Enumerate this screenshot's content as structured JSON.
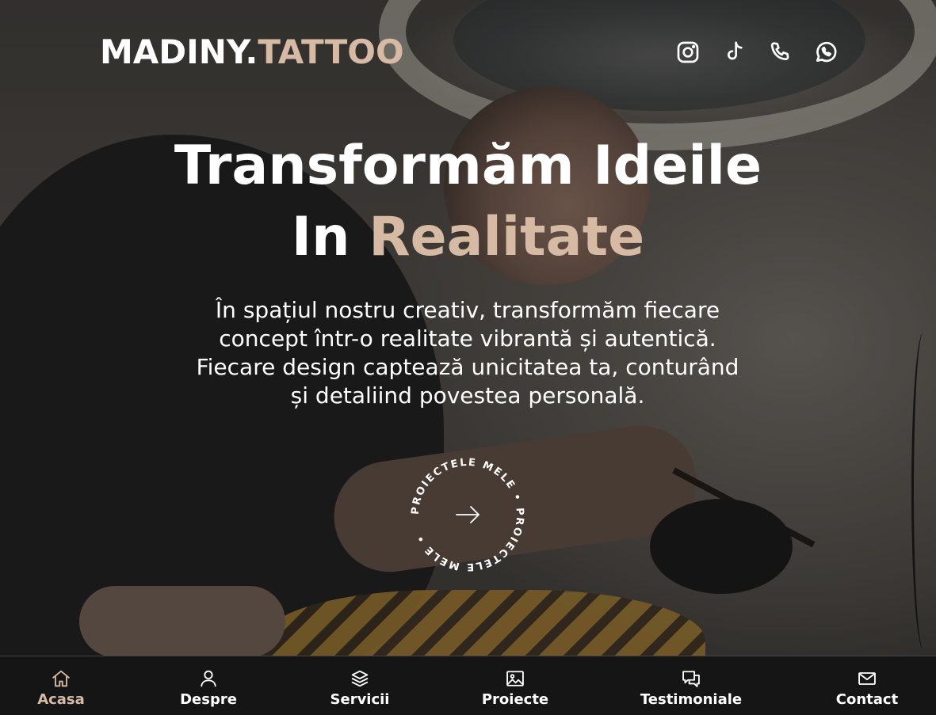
{
  "header": {
    "brand_main": "MADINY.",
    "brand_accent": "TATTOO",
    "socials": [
      {
        "icon": "instagram-icon"
      },
      {
        "icon": "tiktok-icon"
      },
      {
        "icon": "phone-icon"
      },
      {
        "icon": "whatsapp-icon"
      }
    ]
  },
  "hero": {
    "headline_line1": "Transformăm Ideile",
    "headline_line2_prefix": "In ",
    "headline_line2_accent": "Realitate",
    "lead": "În spațiul nostru creativ, transformăm fiecare concept într-o realitate vibrantă și autentică. Fiecare design captează unicitatea ta, conturând și detaliind povestea personală.",
    "cta_circle_text": "PROIECTELE MELE • PROIECTELE MELE • "
  },
  "colors": {
    "accent": "#d7baa4",
    "text": "#ffffff",
    "nav_background": "#121212"
  },
  "bottom_nav": {
    "items": [
      {
        "label": "Acasa",
        "icon": "home-icon",
        "active": true
      },
      {
        "label": "Despre",
        "icon": "user-icon",
        "active": false
      },
      {
        "label": "Servicii",
        "icon": "layers-icon",
        "active": false
      },
      {
        "label": "Proiecte",
        "icon": "image-icon",
        "active": false
      },
      {
        "label": "Testimoniale",
        "icon": "chat-icon",
        "active": false
      },
      {
        "label": "Contact",
        "icon": "mail-icon",
        "active": false
      }
    ]
  }
}
